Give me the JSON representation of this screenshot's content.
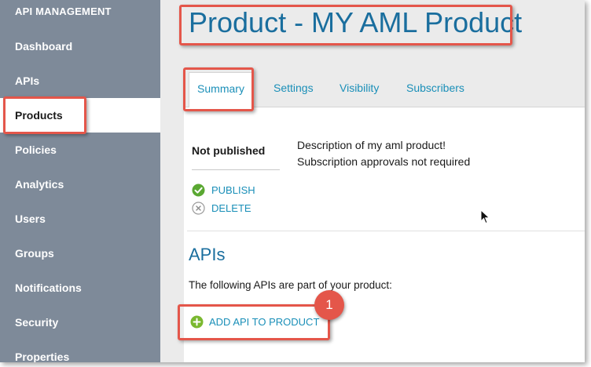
{
  "sidebar": {
    "title": "API MANAGEMENT",
    "items": [
      {
        "label": "Dashboard"
      },
      {
        "label": "APIs"
      },
      {
        "label": "Products"
      },
      {
        "label": "Policies"
      },
      {
        "label": "Analytics"
      },
      {
        "label": "Users"
      },
      {
        "label": "Groups"
      },
      {
        "label": "Notifications"
      },
      {
        "label": "Security"
      },
      {
        "label": "Properties"
      }
    ],
    "active_item": "Products"
  },
  "header": {
    "title": "Product - MY AML Product"
  },
  "tabs": [
    {
      "label": "Summary"
    },
    {
      "label": "Settings"
    },
    {
      "label": "Visibility"
    },
    {
      "label": "Subscribers"
    }
  ],
  "active_tab": "Summary",
  "summary": {
    "status": "Not published",
    "description": "Description of my aml product!",
    "approval": "Subscription approvals not required",
    "publish_label": "PUBLISH",
    "delete_label": "DELETE"
  },
  "apis": {
    "title": "APIs",
    "text": "The following APIs are part of your product:",
    "add_label": "ADD API TO PRODUCT"
  },
  "callout_badge": "1",
  "colors": {
    "sidebar_bg": "#7e8a99",
    "accent": "#1a8fb8",
    "title": "#1a6e9e",
    "callout": "#e4564a",
    "publish_green": "#5aa832",
    "add_green": "#7ab82f"
  },
  "icons": [
    "check-circle-icon",
    "x-circle-icon",
    "plus-circle-icon",
    "mouse-cursor-icon"
  ]
}
